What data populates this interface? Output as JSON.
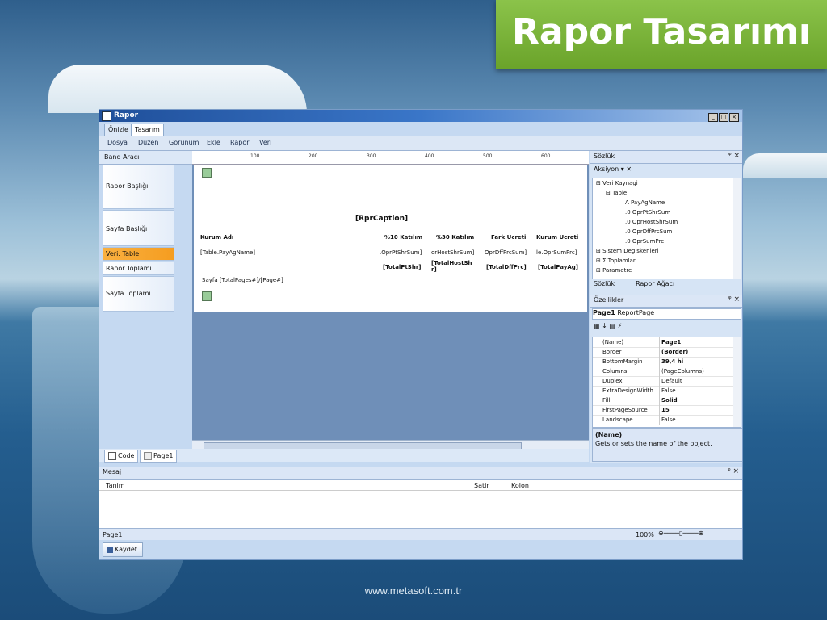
{
  "slide": {
    "title": "Rapor Tasarımı",
    "footer": "www.metasoft.com.tr"
  },
  "window": {
    "title": "Rapor",
    "tabs": [
      "Önizle",
      "Tasarım"
    ],
    "menu": [
      "Dosya",
      "Düzen",
      "Görünüm",
      "Ekle",
      "Rapor",
      "Veri"
    ],
    "band_panel": {
      "header": "Band Aracı",
      "bands": [
        "Rapor Başlığı",
        "Sayfa Başlığı",
        "Veri: Table",
        "Rapor Toplamı",
        "Sayfa Toplamı"
      ]
    },
    "ruler_labels": [
      "100",
      "200",
      "300",
      "400",
      "500",
      "600"
    ],
    "design": {
      "caption": "[RprCaption]",
      "headers": [
        "Kurum Adı",
        "%10 Katılım",
        "%30 Katılım",
        "Fark Ücreti",
        "Kurum Ücreti"
      ],
      "data_row": [
        "[Table.PayAgName]",
        ".OprPtShrSum]",
        "orHostShrSum]",
        "OprDffPrcSum]",
        "le.OprSumPrc]"
      ],
      "totals": [
        "[TotalPtShr]",
        "[TotalHostSh r]",
        "[TotalDffPrc]",
        "[TotalPayAg]"
      ],
      "page_footer": "Sayfa [TotalPages#]/[Page#]"
    },
    "page_tabs": [
      "Code",
      "Page1"
    ],
    "dictionary": {
      "header": "Sözlük",
      "toolbar_label": "Aksiyon",
      "tree": [
        "Veri Kaynagi",
        "Table",
        "PayAgName",
        "OprPtShrSum",
        "OprHostShrSum",
        "OprDffPrcSum",
        "OprSumPrc",
        "Sistem Degiskenleri",
        "Toplamlar",
        "Parametre"
      ],
      "tabs": [
        "Sözlük",
        "Rapor Ağacı"
      ]
    },
    "properties": {
      "header": "Özellikler",
      "object": "Page1",
      "object_type": "ReportPage",
      "rows": [
        {
          "key": "(Name)",
          "value": "Page1"
        },
        {
          "key": "Border",
          "value": "(Border)"
        },
        {
          "key": "BottomMargin",
          "value": "39,4 hi"
        },
        {
          "key": "Columns",
          "value": "(PageColumns)"
        },
        {
          "key": "Duplex",
          "value": "Default"
        },
        {
          "key": "ExtraDesignWidth",
          "value": "False"
        },
        {
          "key": "Fill",
          "value": "Solid"
        },
        {
          "key": "FirstPageSource",
          "value": "15"
        },
        {
          "key": "Landscape",
          "value": "False"
        }
      ],
      "desc_title": "(Name)",
      "desc_text": "Gets or sets the name of the object."
    },
    "messages": {
      "header": "Mesaj",
      "columns": [
        "Tanim",
        "Satir",
        "Kolon"
      ]
    },
    "status": {
      "left": "Page1",
      "zoom": "100%"
    },
    "save_label": "Kaydet"
  }
}
